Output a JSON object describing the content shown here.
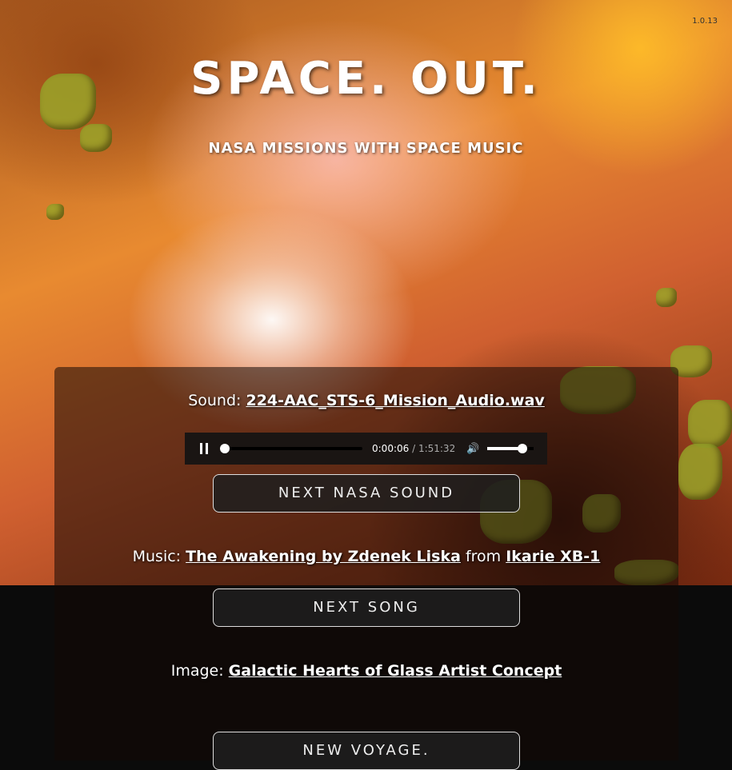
{
  "version": "1.0.13",
  "header": {
    "title": "SPACE. OUT.",
    "subtitle": "NASA MISSIONS WITH SPACE MUSIC"
  },
  "sound": {
    "label": "Sound:",
    "file": "224-AAC_STS-6_Mission_Audio.wav"
  },
  "player": {
    "current_time": "0:00:06",
    "separator": " / ",
    "duration": "1:51:32",
    "progress_percent": 0.1,
    "volume_percent": 75
  },
  "buttons": {
    "next_sound": "NEXT NASA SOUND",
    "next_song": "NEXT SONG",
    "new_voyage": "NEW VOYAGE."
  },
  "music": {
    "label": "Music:",
    "song": "The Awakening by Zdenek Liska",
    "from": "from",
    "source": "Ikarie XB-1"
  },
  "image": {
    "label": "Image:",
    "title": "Galactic Hearts of Glass Artist Concept"
  }
}
